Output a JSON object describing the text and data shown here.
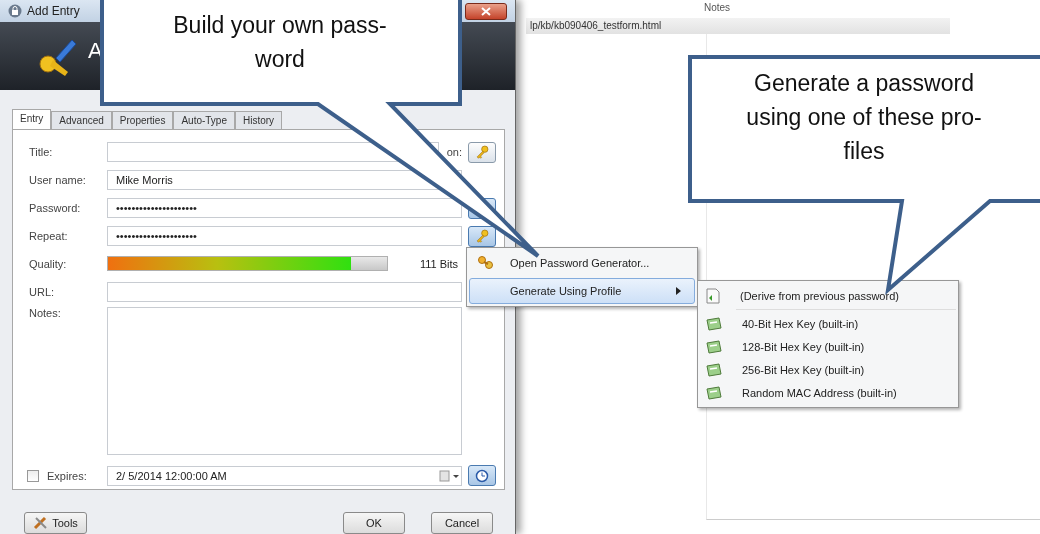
{
  "dialog": {
    "title": "Add Entry",
    "header_title": "A",
    "tabs": [
      {
        "label": "Entry",
        "selected": true
      },
      {
        "label": "Advanced",
        "selected": false
      },
      {
        "label": "Properties",
        "selected": false
      },
      {
        "label": "Auto-Type",
        "selected": false
      },
      {
        "label": "History",
        "selected": false
      }
    ],
    "fields": [
      {
        "kind": "title",
        "label": "Title:",
        "side_label": "on:"
      },
      {
        "kind": "text",
        "label": "User name:",
        "value": "Mike Morris"
      },
      {
        "kind": "password",
        "label": "Password:",
        "value": "•••••••••••••••••••••"
      },
      {
        "kind": "repeat",
        "label": "Repeat:",
        "value": "•••••••••••••••••••••"
      },
      {
        "kind": "quality",
        "label": "Quality:",
        "level": 0.87,
        "reading": "111 Bits"
      },
      {
        "kind": "text",
        "label": "URL:"
      },
      {
        "kind": "notes",
        "label": "Notes:"
      }
    ],
    "expires": {
      "label": "Expires:",
      "checked": false,
      "value": "2/ 5/2014 12:00:00 AM"
    },
    "buttons": [
      {
        "kind": "tools",
        "label": "Tools"
      },
      {
        "kind": "ok",
        "label": "OK"
      },
      {
        "kind": "cancel",
        "label": "Cancel"
      }
    ]
  },
  "menu": [
    {
      "kind": "generator",
      "label": "Open Password Generator...",
      "selected": false
    },
    {
      "kind": "submenu",
      "label": "Generate Using Profile",
      "selected": true
    }
  ],
  "submenu": [
    {
      "kind": "derive",
      "label": "(Derive from previous password)"
    },
    {
      "kind": "profile",
      "label": "40-Bit Hex Key (built-in)"
    },
    {
      "kind": "profile",
      "label": "128-Bit Hex Key (built-in)"
    },
    {
      "kind": "profile",
      "label": "256-Bit Hex Key (built-in)"
    },
    {
      "kind": "profile",
      "label": "Random MAC Address (built-in)"
    }
  ],
  "background": {
    "column_header": "Notes",
    "url": "lp/kb/kb090406_testform.html"
  },
  "callouts": [
    {
      "lines": [
        "Build your own pass-",
        "word"
      ]
    },
    {
      "lines": [
        "Generate a password",
        "using one of these pro-",
        "files"
      ]
    }
  ]
}
